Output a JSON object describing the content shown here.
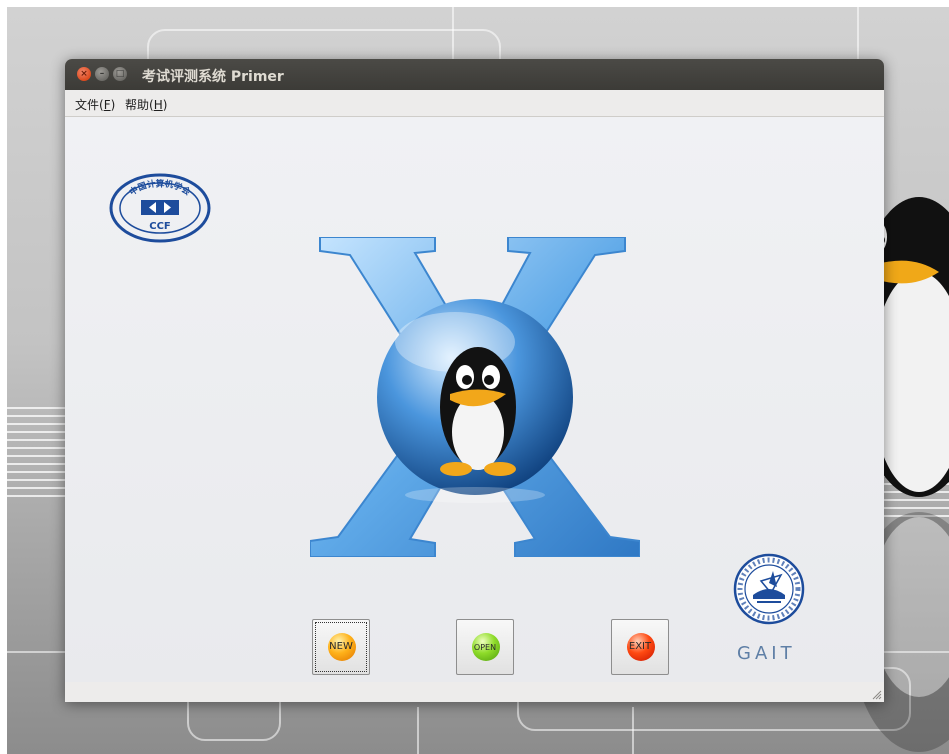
{
  "window": {
    "title": "考试评测系统 Primer"
  },
  "menubar": {
    "file": {
      "label": "文件(",
      "mnemonic": "F",
      "close": ")"
    },
    "help": {
      "label": "帮助(",
      "mnemonic": "H",
      "close": ")"
    }
  },
  "logos": {
    "ccf_text_top": "中国计算机学会",
    "ccf_text_bottom": "CCF",
    "gait_label": "GAIT"
  },
  "buttons": {
    "new": "NEW",
    "open": "OPEN",
    "exit": "EXIT"
  },
  "colors": {
    "title_bar": "#3c3b37",
    "close_button": "#dc4a1e",
    "new_ball": "#ffb21a",
    "open_ball": "#8fdc2a",
    "exit_ball": "#ff4a12",
    "gait_blue": "#1d4c9c"
  }
}
